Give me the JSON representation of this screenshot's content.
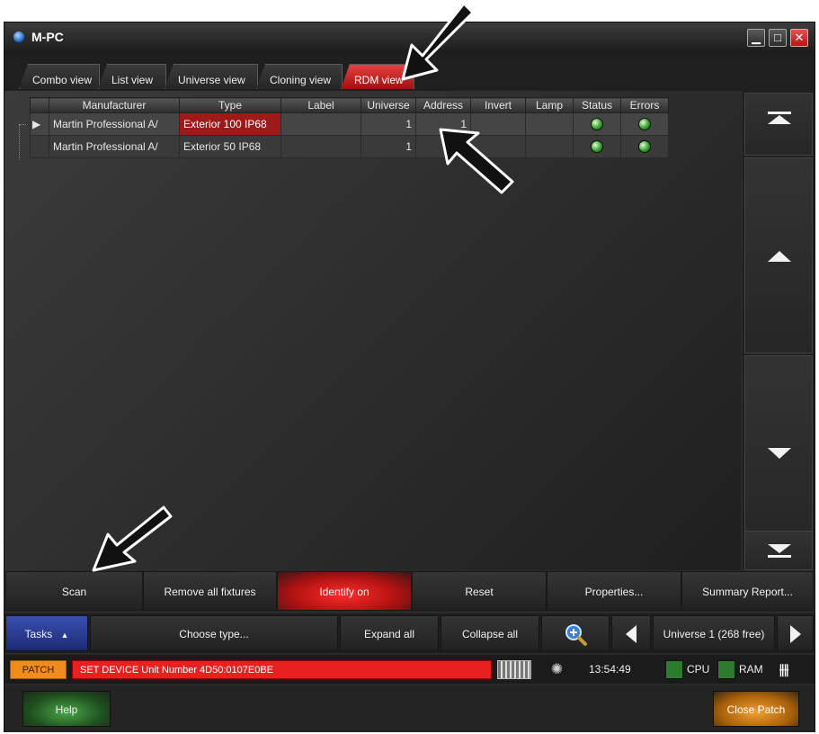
{
  "window": {
    "title": "M-PC"
  },
  "tabs": [
    {
      "label": "Combo view"
    },
    {
      "label": "List view"
    },
    {
      "label": "Universe view"
    },
    {
      "label": "Cloning view"
    },
    {
      "label": "RDM view",
      "active": true
    }
  ],
  "grid": {
    "columns": [
      "Manufacturer",
      "Type",
      "Label",
      "Universe",
      "Address",
      "Invert",
      "Lamp",
      "Status",
      "Errors"
    ],
    "rows": [
      {
        "manufacturer": "Martin Professional A/",
        "type": "Exterior 100 IP68",
        "label": "",
        "universe": "1",
        "address": "1",
        "invert": "",
        "lamp": "",
        "status": "ok",
        "errors": "ok",
        "selected": true
      },
      {
        "manufacturer": "Martin Professional A/",
        "type": "Exterior 50  IP68",
        "label": "",
        "universe": "1",
        "address": "",
        "invert": "",
        "lamp": "",
        "status": "ok",
        "errors": "ok"
      }
    ]
  },
  "actions": {
    "scan": "Scan",
    "remove_all": "Remove all fixtures",
    "identify": "Identify on",
    "reset": "Reset",
    "properties": "Properties...",
    "summary": "Summary Report..."
  },
  "taskbar": {
    "tasks": "Tasks",
    "choose_type": "Choose type...",
    "expand_all": "Expand all",
    "collapse_all": "Collapse all",
    "universe": "Universe 1 (268 free)"
  },
  "status": {
    "mode": "PATCH",
    "message": "SET DEVICE Unit Number 4D50:0107E0BE",
    "time": "13:54:49",
    "cpu": "CPU",
    "ram": "RAM"
  },
  "footer": {
    "help": "Help",
    "close": "Close Patch"
  },
  "colors": {
    "accent_red": "#e82020",
    "patch_orange": "#f08c1c",
    "status_green": "#38a030"
  },
  "icons": [
    "minimize-icon",
    "maximize-icon",
    "close-icon",
    "scroll-top-icon",
    "scroll-up-icon",
    "scroll-down-icon",
    "scroll-bottom-icon",
    "zoom-in-icon",
    "arrow-left-icon",
    "arrow-right-icon",
    "keyboard-icon",
    "spinner-icon",
    "mixer-icon"
  ]
}
